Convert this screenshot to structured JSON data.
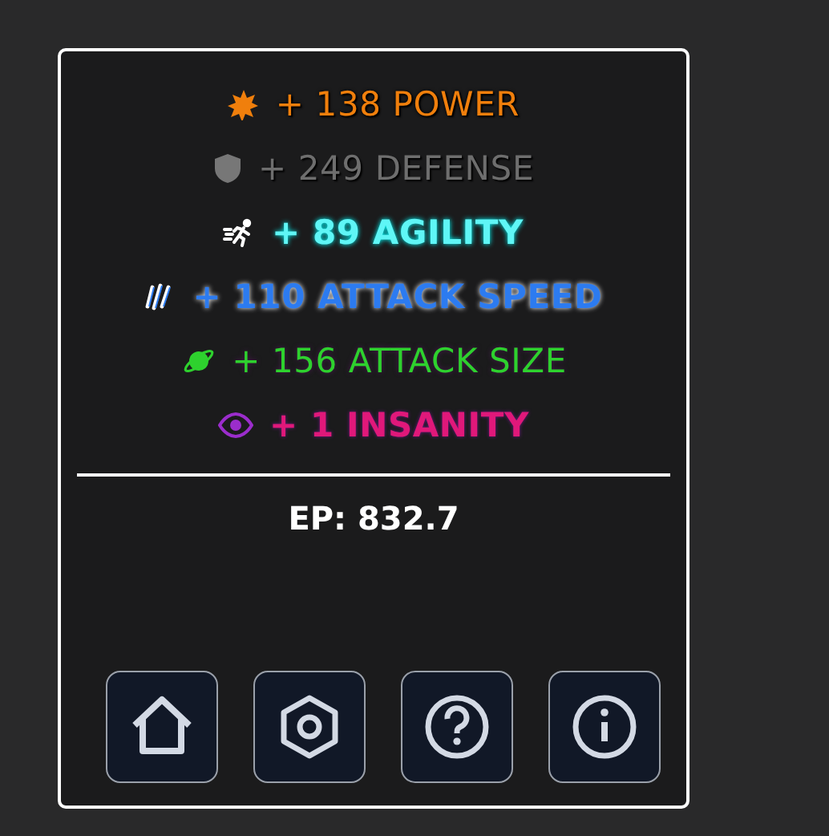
{
  "stats": [
    {
      "kind": "power",
      "text": "+ 138 POWER",
      "color": "#f07f0c"
    },
    {
      "kind": "defense",
      "text": "+ 249 DEFENSE",
      "color": "#6e6e6e"
    },
    {
      "kind": "agility",
      "text": "+ 89 AGILITY",
      "color": "#5ff6f6"
    },
    {
      "kind": "speed",
      "text": "+ 110 ATTACK SPEED",
      "color": "#2c7bf0"
    },
    {
      "kind": "size",
      "text": "+ 156 ATTACK SIZE",
      "color": "#2ed12e"
    },
    {
      "kind": "insanity",
      "text": "+ 1 INSANITY",
      "color": "#e0187a"
    }
  ],
  "ep": "EP: 832.7",
  "buttons": [
    {
      "kind": "home"
    },
    {
      "kind": "settings"
    },
    {
      "kind": "help"
    },
    {
      "kind": "info"
    }
  ]
}
